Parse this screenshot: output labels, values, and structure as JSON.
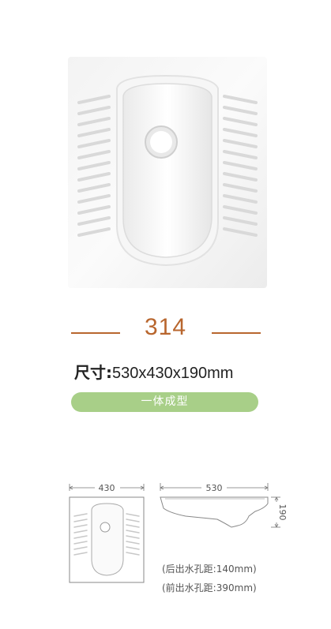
{
  "product": {
    "model": "314",
    "size_label": "尺寸:",
    "size_value": "530x430x190mm",
    "feature_tag": "一体成型"
  },
  "diagram": {
    "width_label": "430",
    "length_label": "530",
    "height_label": "190",
    "rear_outlet_note": "(后出水孔距:140mm)",
    "front_outlet_note": "(前出水孔距:390mm)"
  },
  "colors": {
    "accent": "#b8662e",
    "tag_bg": "#a8cf88"
  }
}
